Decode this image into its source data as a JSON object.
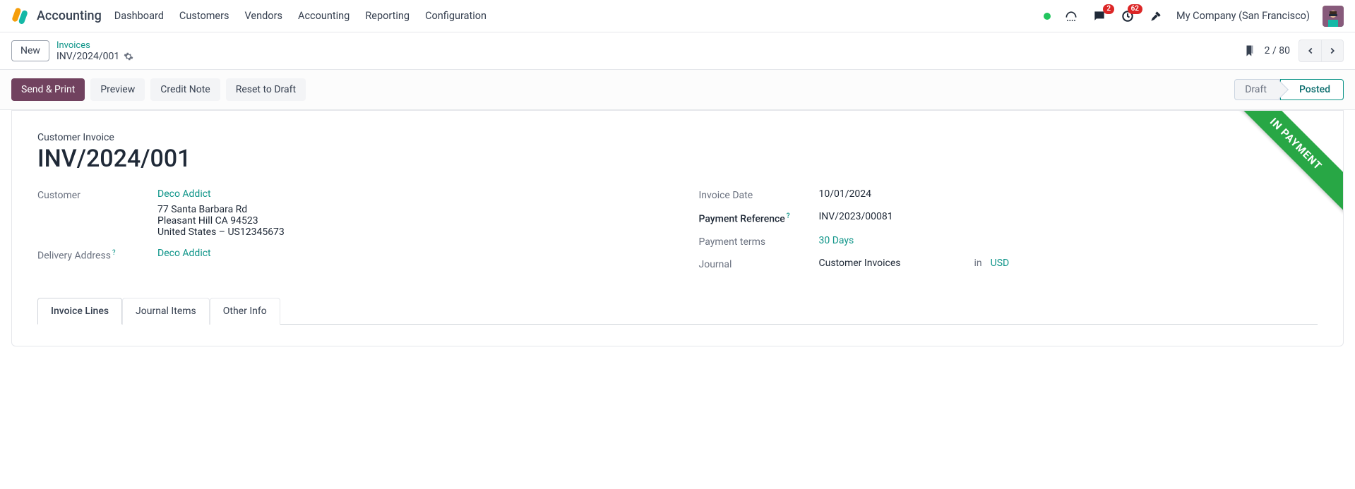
{
  "app": {
    "name": "Accounting"
  },
  "nav": {
    "links": [
      "Dashboard",
      "Customers",
      "Vendors",
      "Accounting",
      "Reporting",
      "Configuration"
    ]
  },
  "topright": {
    "chat_badge": "2",
    "activity_badge": "62",
    "company": "My Company (San Francisco)"
  },
  "breadcrumb": {
    "new": "New",
    "parent": "Invoices",
    "current": "INV/2024/001"
  },
  "pager": {
    "text": "2 / 80"
  },
  "actions": {
    "send_print": "Send & Print",
    "preview": "Preview",
    "credit_note": "Credit Note",
    "reset_draft": "Reset to Draft"
  },
  "status": {
    "draft": "Draft",
    "posted": "Posted"
  },
  "ribbon": "IN PAYMENT",
  "form": {
    "type_label": "Customer Invoice",
    "name": "INV/2024/001",
    "customer_label": "Customer",
    "customer_name": "Deco Addict",
    "customer_addr1": "77 Santa Barbara Rd",
    "customer_addr2": "Pleasant Hill CA 94523",
    "customer_addr3": "United States – US12345673",
    "delivery_label": "Delivery Address",
    "delivery_value": "Deco Addict",
    "invoice_date_label": "Invoice Date",
    "invoice_date": "10/01/2024",
    "payment_ref_label": "Payment Reference",
    "payment_ref": "INV/2023/00081",
    "payment_terms_label": "Payment terms",
    "payment_terms": "30 Days",
    "journal_label": "Journal",
    "journal": "Customer Invoices",
    "in_label": "in",
    "currency": "USD"
  },
  "tabs": {
    "invoice_lines": "Invoice Lines",
    "journal_items": "Journal Items",
    "other_info": "Other Info"
  }
}
